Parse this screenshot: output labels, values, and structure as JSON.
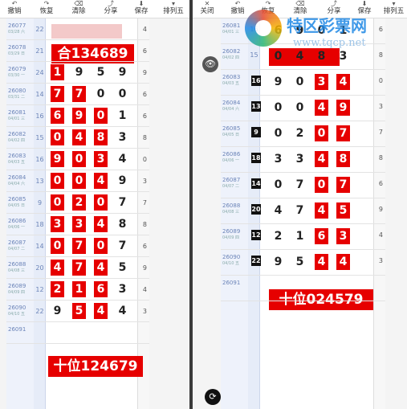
{
  "left_toolbar": [
    "撤销",
    "恢复",
    "清除",
    "分享",
    "保存",
    "排列五"
  ],
  "right_toolbar": [
    "关闭",
    "撤销",
    "恢复",
    "清除",
    "分享",
    "保存",
    "排列五"
  ],
  "left": {
    "rows": [
      {
        "issue": "26077",
        "date": "03/28 六",
        "sum": "22",
        "cells": [
          "",
          "",
          "",
          "",
          ""
        ],
        "rv": "4"
      },
      {
        "issue": "26078",
        "date": "03/29 日",
        "sum": "21",
        "cells": [
          "",
          "",
          "",
          "",
          ""
        ],
        "rv": "6"
      },
      {
        "issue": "26079",
        "date": "03/30 一",
        "sum": "24",
        "cells": [
          "1",
          "9",
          "5",
          "9",
          ""
        ],
        "red": [
          0
        ],
        "rv": "9"
      },
      {
        "issue": "26080",
        "date": "03/31 二",
        "sum": "14",
        "cells": [
          "7",
          "7",
          "0",
          "0",
          ""
        ],
        "red": [
          0,
          1
        ],
        "rv": "6"
      },
      {
        "issue": "26081",
        "date": "04/01 三",
        "sum": "16",
        "cells": [
          "6",
          "9",
          "0",
          "1",
          ""
        ],
        "red": [
          0,
          1,
          2
        ],
        "rv": "6"
      },
      {
        "issue": "26082",
        "date": "04/02 四",
        "sum": "15",
        "cells": [
          "0",
          "4",
          "8",
          "3",
          ""
        ],
        "red": [
          0,
          1,
          2
        ],
        "rv": "8"
      },
      {
        "issue": "26083",
        "date": "04/03 五",
        "sum": "16",
        "cells": [
          "9",
          "0",
          "3",
          "4",
          ""
        ],
        "red": [
          0,
          1,
          2
        ],
        "rv": "0"
      },
      {
        "issue": "26084",
        "date": "04/04 六",
        "sum": "13",
        "cells": [
          "0",
          "0",
          "4",
          "9",
          ""
        ],
        "red": [
          0,
          1,
          2
        ],
        "rv": "3"
      },
      {
        "issue": "26085",
        "date": "04/05 日",
        "sum": "9",
        "cells": [
          "0",
          "2",
          "0",
          "7",
          ""
        ],
        "red": [
          0,
          1,
          2
        ],
        "rv": "7"
      },
      {
        "issue": "26086",
        "date": "04/06 一",
        "sum": "18",
        "cells": [
          "3",
          "3",
          "4",
          "8",
          ""
        ],
        "red": [
          0,
          1,
          2
        ],
        "rv": "8"
      },
      {
        "issue": "26087",
        "date": "04/07 二",
        "sum": "14",
        "cells": [
          "0",
          "7",
          "0",
          "7",
          ""
        ],
        "red": [
          0,
          1,
          2
        ],
        "rv": "6"
      },
      {
        "issue": "26088",
        "date": "04/08 三",
        "sum": "20",
        "cells": [
          "4",
          "7",
          "4",
          "5",
          ""
        ],
        "red": [
          0,
          1,
          2
        ],
        "rv": "9"
      },
      {
        "issue": "26089",
        "date": "04/09 四",
        "sum": "12",
        "cells": [
          "2",
          "1",
          "6",
          "3",
          ""
        ],
        "red": [
          0,
          1,
          2
        ],
        "rv": "4"
      },
      {
        "issue": "26090",
        "date": "04/10 五",
        "sum": "22",
        "cells": [
          "9",
          "5",
          "4",
          "4",
          ""
        ],
        "red": [
          1,
          2
        ],
        "rv": "3"
      },
      {
        "issue": "26091",
        "date": "",
        "sum": "",
        "cells": [
          "",
          "",
          "",
          "",
          ""
        ],
        "rv": ""
      }
    ],
    "top_label": "合134689",
    "bottom_label": "十位124679"
  },
  "right": {
    "rows": [
      {
        "issue": "26081",
        "date": "04/01 三",
        "sum": "16",
        "cells": [
          "6",
          "9",
          "0",
          "1",
          ""
        ],
        "red": [],
        "rv": "6"
      },
      {
        "issue": "26082",
        "date": "04/02 四",
        "sum": "15",
        "cells": [
          "0",
          "4",
          "8",
          "3",
          ""
        ],
        "red": [],
        "rv": "8"
      },
      {
        "issue": "26083",
        "date": "04/03 五",
        "sum": "16",
        "box": true,
        "cells": [
          "9",
          "0",
          "3",
          "4",
          ""
        ],
        "red": [
          2,
          3
        ],
        "rv": "0"
      },
      {
        "issue": "26084",
        "date": "04/04 六",
        "sum": "13",
        "box": true,
        "cells": [
          "0",
          "0",
          "4",
          "9",
          ""
        ],
        "red": [
          2,
          3
        ],
        "rv": "3"
      },
      {
        "issue": "26085",
        "date": "04/05 日",
        "sum": "9",
        "box": true,
        "cells": [
          "0",
          "2",
          "0",
          "7",
          ""
        ],
        "red": [
          2,
          3
        ],
        "rv": "7"
      },
      {
        "issue": "26086",
        "date": "04/06 一",
        "sum": "18",
        "box": true,
        "cells": [
          "3",
          "3",
          "4",
          "8",
          ""
        ],
        "red": [
          2,
          3
        ],
        "rv": "8"
      },
      {
        "issue": "26087",
        "date": "04/07 二",
        "sum": "14",
        "box": true,
        "cells": [
          "0",
          "7",
          "0",
          "7",
          ""
        ],
        "red": [
          2,
          3
        ],
        "rv": "6"
      },
      {
        "issue": "26088",
        "date": "04/08 三",
        "sum": "20",
        "box": true,
        "cells": [
          "4",
          "7",
          "4",
          "5",
          ""
        ],
        "red": [
          2,
          3
        ],
        "rv": "9"
      },
      {
        "issue": "26089",
        "date": "04/09 四",
        "sum": "12",
        "box": true,
        "cells": [
          "2",
          "1",
          "6",
          "3",
          ""
        ],
        "red": [
          2,
          3
        ],
        "rv": "4"
      },
      {
        "issue": "26090",
        "date": "04/10 五",
        "sum": "22",
        "box": true,
        "cells": [
          "9",
          "5",
          "4",
          "4",
          ""
        ],
        "red": [
          2,
          3
        ],
        "rv": "3"
      },
      {
        "issue": "26091",
        "date": "",
        "sum": "",
        "cells": [
          "",
          "",
          "",
          "",
          ""
        ],
        "red": [],
        "rv": ""
      }
    ],
    "bottom_label": "十位024579"
  },
  "watermark": {
    "title": "特区彩票网",
    "url": "www.tqcp.net"
  },
  "icons": {
    "eye": "eye-icon",
    "sync": "sync-icon"
  }
}
